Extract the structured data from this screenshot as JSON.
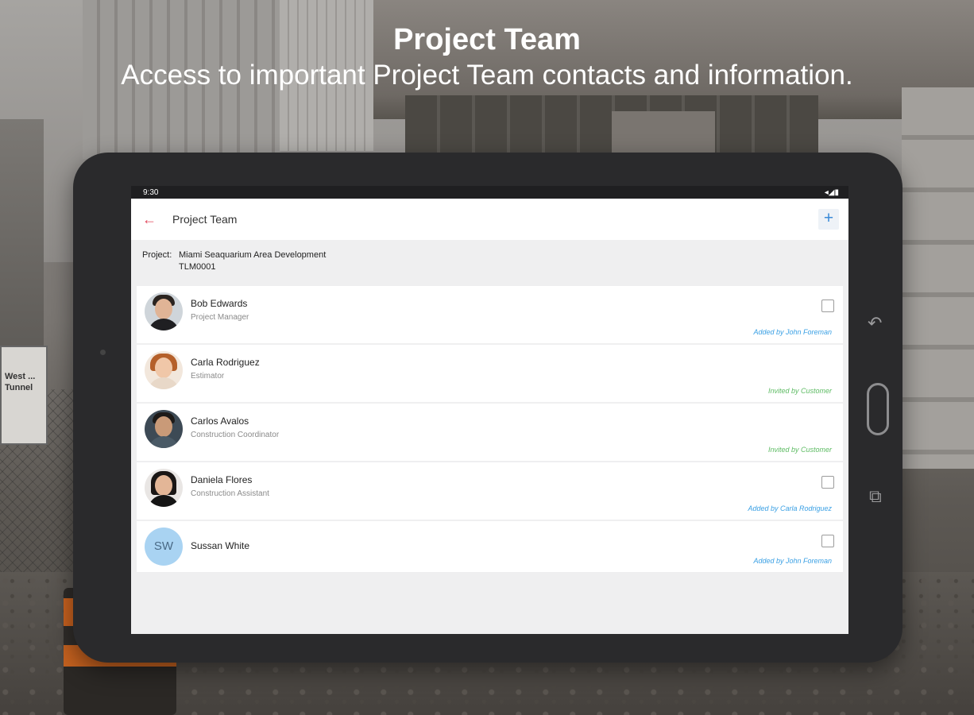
{
  "headline": {
    "title": "Project Team",
    "subtitle": "Access to important Project Team contacts and information."
  },
  "scene": {
    "sign_text": "West ... Tunnel"
  },
  "statusbar": {
    "time": "9:30",
    "icons": "◂◢▮"
  },
  "appbar": {
    "title": "Project Team",
    "back_icon": "←",
    "add_icon": "+"
  },
  "project": {
    "label": "Project:",
    "name": "Miami Seaquarium Area Development",
    "code": "TLM0001"
  },
  "team": [
    {
      "name": "Bob Edwards",
      "role": "Project Manager",
      "added_by": "Added by John Foreman",
      "added_color": "#3aa0e4",
      "checkbox": true
    },
    {
      "name": "Carla Rodriguez",
      "role": "Estimator",
      "added_by": "Invited by Customer",
      "added_color": "#5dbb63",
      "checkbox": false
    },
    {
      "name": "Carlos Avalos",
      "role": "Construction Coordinator",
      "added_by": "Invited by Customer",
      "added_color": "#5dbb63",
      "checkbox": false
    },
    {
      "name": "Daniela Flores",
      "role": "Construction Assistant",
      "added_by": "Added by Carla Rodriguez",
      "added_color": "#3aa0e4",
      "checkbox": true
    },
    {
      "name": "Sussan White",
      "role": "",
      "initials": "SW",
      "added_by": "Added by John Foreman",
      "added_color": "#3aa0e4",
      "checkbox": true
    }
  ],
  "hardware": {
    "back_icon": "↶",
    "recent_icon": "⧉"
  },
  "colors": {
    "accent_red": "#e2475c",
    "accent_blue": "#3b8bd8",
    "added_blue": "#3aa0e4",
    "invited_green": "#5dbb63",
    "initials_bg": "#a9d3f2"
  }
}
